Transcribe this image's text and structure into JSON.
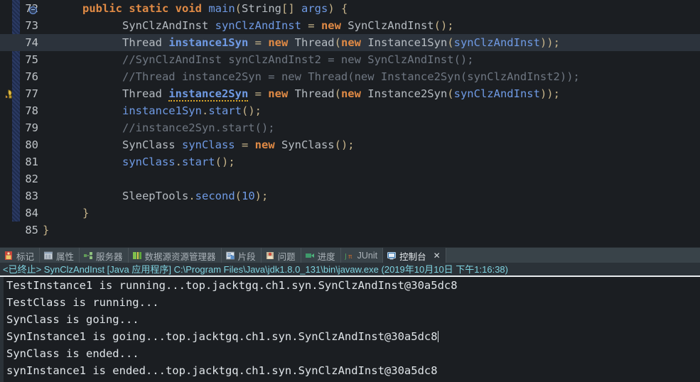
{
  "editor": {
    "lines": [
      {
        "num": "72",
        "marker": "collapse",
        "current": false,
        "tokens": [
          {
            "t": "kw",
            "s": "public "
          },
          {
            "t": "kw",
            "s": "static "
          },
          {
            "t": "kw",
            "s": "void "
          },
          {
            "t": "mthb",
            "s": "main"
          },
          {
            "t": "pun",
            "s": "("
          },
          {
            "t": "typ",
            "s": "String"
          },
          {
            "t": "pun",
            "s": "[] "
          },
          {
            "t": "var",
            "s": "args"
          },
          {
            "t": "pun",
            "s": ") {"
          }
        ],
        "indent": 3
      },
      {
        "num": "73",
        "marker": "",
        "current": false,
        "tokens": [
          {
            "t": "typ",
            "s": "SynClzAndInst "
          },
          {
            "t": "var",
            "s": "synClzAndInst "
          },
          {
            "t": "pun",
            "s": "= "
          },
          {
            "t": "kw",
            "s": "new "
          },
          {
            "t": "typ",
            "s": "SynClzAndInst"
          },
          {
            "t": "pun",
            "s": "();"
          }
        ],
        "indent": 6
      },
      {
        "num": "74",
        "marker": "",
        "current": true,
        "tokens": [
          {
            "t": "typ",
            "s": "Thread "
          },
          {
            "t": "varb",
            "s": "instance1Syn "
          },
          {
            "t": "pun",
            "s": "= "
          },
          {
            "t": "kw",
            "s": "new "
          },
          {
            "t": "typ",
            "s": "Thread"
          },
          {
            "t": "pun",
            "s": "("
          },
          {
            "t": "kw",
            "s": "new "
          },
          {
            "t": "typ",
            "s": "Instance1Syn"
          },
          {
            "t": "pun",
            "s": "("
          },
          {
            "t": "var",
            "s": "synClzAndInst"
          },
          {
            "t": "pun",
            "s": "));"
          }
        ],
        "indent": 6
      },
      {
        "num": "75",
        "marker": "",
        "current": false,
        "tokens": [
          {
            "t": "cmt",
            "s": "//SynClzAndInst synClzAndInst2 = new SynClzAndInst();"
          }
        ],
        "indent": 6
      },
      {
        "num": "76",
        "marker": "",
        "current": false,
        "tokens": [
          {
            "t": "cmt",
            "s": "//Thread instance2Syn = new Thread(new Instance2Syn(synClzAndInst2));"
          }
        ],
        "indent": 6
      },
      {
        "num": "77",
        "marker": "warning",
        "current": false,
        "tokens": [
          {
            "t": "typ",
            "s": "Thread "
          },
          {
            "t": "varbw",
            "s": "instance2Syn"
          },
          {
            "t": "pun",
            "s": " = "
          },
          {
            "t": "kw",
            "s": "new "
          },
          {
            "t": "typ",
            "s": "Thread"
          },
          {
            "t": "pun",
            "s": "("
          },
          {
            "t": "kw",
            "s": "new "
          },
          {
            "t": "typ",
            "s": "Instance2Syn"
          },
          {
            "t": "pun",
            "s": "("
          },
          {
            "t": "var",
            "s": "synClzAndInst"
          },
          {
            "t": "pun",
            "s": "));"
          }
        ],
        "indent": 6
      },
      {
        "num": "78",
        "marker": "",
        "current": false,
        "tokens": [
          {
            "t": "var",
            "s": "instance1Syn"
          },
          {
            "t": "pun",
            "s": "."
          },
          {
            "t": "mth",
            "s": "start"
          },
          {
            "t": "pun",
            "s": "();"
          }
        ],
        "indent": 6
      },
      {
        "num": "79",
        "marker": "",
        "current": false,
        "tokens": [
          {
            "t": "cmt",
            "s": "//instance2Syn.start();"
          }
        ],
        "indent": 6
      },
      {
        "num": "80",
        "marker": "",
        "current": false,
        "tokens": [
          {
            "t": "typ",
            "s": "SynClass "
          },
          {
            "t": "var",
            "s": "synClass "
          },
          {
            "t": "pun",
            "s": "= "
          },
          {
            "t": "kw",
            "s": "new "
          },
          {
            "t": "typ",
            "s": "SynClass"
          },
          {
            "t": "pun",
            "s": "();"
          }
        ],
        "indent": 6
      },
      {
        "num": "81",
        "marker": "",
        "current": false,
        "tokens": [
          {
            "t": "var",
            "s": "synClass"
          },
          {
            "t": "pun",
            "s": "."
          },
          {
            "t": "mth",
            "s": "start"
          },
          {
            "t": "pun",
            "s": "();"
          }
        ],
        "indent": 6
      },
      {
        "num": "82",
        "marker": "",
        "current": false,
        "tokens": [],
        "indent": 0
      },
      {
        "num": "83",
        "marker": "",
        "current": false,
        "tokens": [
          {
            "t": "typ",
            "s": "SleepTools"
          },
          {
            "t": "pun",
            "s": "."
          },
          {
            "t": "mth",
            "s": "second"
          },
          {
            "t": "pun",
            "s": "("
          },
          {
            "t": "num",
            "s": "10"
          },
          {
            "t": "pun",
            "s": ");"
          }
        ],
        "indent": 6
      },
      {
        "num": "84",
        "marker": "",
        "current": false,
        "tokens": [
          {
            "t": "pun",
            "s": "}"
          }
        ],
        "indent": 3
      },
      {
        "num": "85",
        "marker": "",
        "current": false,
        "tokens": [
          {
            "t": "pun",
            "s": "}"
          }
        ],
        "indent": 0
      }
    ]
  },
  "tabbar": {
    "tabs": [
      {
        "label": "标记",
        "icon": "marker-icon",
        "active": false,
        "closable": false
      },
      {
        "label": "属性",
        "icon": "properties-icon",
        "active": false,
        "closable": false
      },
      {
        "label": "服务器",
        "icon": "servers-icon",
        "active": false,
        "closable": false
      },
      {
        "label": "数据源资源管理器",
        "icon": "datasource-explorer-icon",
        "active": false,
        "closable": false
      },
      {
        "label": "片段",
        "icon": "snippets-icon",
        "active": false,
        "closable": false
      },
      {
        "label": "问题",
        "icon": "problems-icon",
        "active": false,
        "closable": false
      },
      {
        "label": "进度",
        "icon": "progress-icon",
        "active": false,
        "closable": false
      },
      {
        "label": "JUnit",
        "icon": "junit-icon",
        "active": false,
        "closable": false
      },
      {
        "label": "控制台",
        "icon": "console-icon",
        "active": true,
        "closable": true
      }
    ],
    "close_glyph": "✕"
  },
  "console_header": {
    "text": "<已终止> SynClzAndInst [Java 应用程序] C:\\Program Files\\Java\\jdk1.8.0_131\\bin\\javaw.exe  (2019年10月10日 下午1:16:38)"
  },
  "console": {
    "lines": [
      {
        "text": "TestInstance1 is running...top.jacktgq.ch1.syn.SynClzAndInst@30a5dc8",
        "caret": false
      },
      {
        "text": "TestClass is running...",
        "caret": false
      },
      {
        "text": "SynClass is going...",
        "caret": false
      },
      {
        "text": "SynInstance1 is going...top.jacktgq.ch1.syn.SynClzAndInst@30a5dc8",
        "caret": true
      },
      {
        "text": "SynClass is ended...",
        "caret": false
      },
      {
        "text": "synInstance1 is ended...top.jacktgq.ch1.syn.SynClzAndInst@30a5dc8",
        "caret": false
      }
    ]
  },
  "colors": {
    "editor_bg": "#1b1e22",
    "current_line_bg": "#2c333c",
    "tabbar_bg": "#394349",
    "active_tab_bg": "#2b3238",
    "keyword": "#e08a45",
    "variable": "#6f9ae4",
    "comment": "#6f7782",
    "console_text": "#dfe4e8",
    "console_header_text": "#7fd3e0",
    "warning_squiggle": "#d9a62a"
  }
}
